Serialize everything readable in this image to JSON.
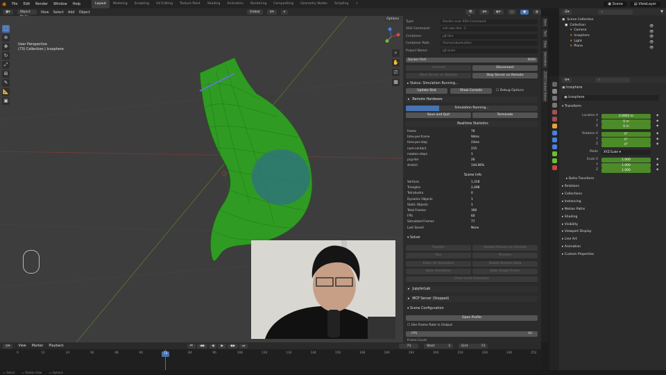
{
  "menu": [
    "File",
    "Edit",
    "Render",
    "Window",
    "Help"
  ],
  "workspaces": [
    "Layout",
    "Modeling",
    "Sculpting",
    "UV Editing",
    "Texture Paint",
    "Shading",
    "Animation",
    "Rendering",
    "Compositing",
    "Geometry Nodes",
    "Scripting"
  ],
  "active_workspace": "Layout",
  "scene_name": "Scene",
  "view_layer": "ViewLayer",
  "viewport": {
    "mode": "Object Mode",
    "menus": [
      "View",
      "Select",
      "Add",
      "Object"
    ],
    "transform_orientation": "Global",
    "options": "Options",
    "overlay_line1": "User Perspective",
    "overlay_line2": "(73) Collection | Icosphere"
  },
  "addon": {
    "fields": [
      {
        "k": "Type",
        "v": "Docker over SSH Command"
      },
      {
        "k": "SSH Command",
        "v": "ssh aws-dev -1"
      },
      {
        "k": "Container",
        "v": "pjf-dev"
      },
      {
        "k": "Container Path",
        "v": "/home/ubuntu/dev"
      },
      {
        "k": "Project Name",
        "v": "pjf-anim"
      }
    ],
    "docker_port_label": "Docker Port",
    "docker_port": "9090",
    "connect": "Connect",
    "disconnect": "Disconnect",
    "start_server": "Start Server on Remote",
    "stop_server": "Stop Server on Remote",
    "status": "Status: Simulation Running...",
    "update_stat": "Update Stat",
    "show_console": "Show Console",
    "debug_options": "Debug Options",
    "remote_hardware": "Remote Hardware",
    "progress_label": "Simulation Running...",
    "progress": 0.25,
    "save_quit": "Save and Quit",
    "terminate": "Terminate",
    "realtime_title": "Realtime Statistics",
    "realtime": [
      {
        "k": "frame",
        "v": "76"
      },
      {
        "k": "time-per-frame",
        "v": "94ms"
      },
      {
        "k": "time-per-step",
        "v": "23ms"
      },
      {
        "k": "num-contact",
        "v": "215"
      },
      {
        "k": "newton-steps",
        "v": "1"
      },
      {
        "k": "pcg-iter",
        "v": "26"
      },
      {
        "k": "stretch",
        "v": "144.06%"
      }
    ],
    "scene_info_title": "Scene Info",
    "scene_info": [
      {
        "k": "Vertices",
        "v": "1,318"
      },
      {
        "k": "Triangles",
        "v": "2,498"
      },
      {
        "k": "Tetrahedra",
        "v": "0"
      },
      {
        "k": "Dynamic Objects",
        "v": "1"
      },
      {
        "k": "Static Objects",
        "v": "1"
      },
      {
        "k": "Total Frames",
        "v": "300"
      },
      {
        "k": "FPS",
        "v": "60"
      },
      {
        "k": "Simulated Frames",
        "v": "77"
      },
      {
        "k": "Last Saved",
        "v": "None"
      }
    ],
    "solver_title": "Solver",
    "solver_buttons": [
      "Transfer",
      "Update Params on Remote",
      "Run",
      "Resume",
      "Fetch All Animation",
      "Delete Remote Data",
      "Bake Animation",
      "Bake Single Frame",
      "Clear Local Animation"
    ],
    "jupyter": "JupyterLab",
    "mcp": "MCP Server (Stopped)",
    "scene_config": "Scene Configuration",
    "open_profile": "Open Profile",
    "use_frame_rate": "Use Frame Rate in Output",
    "fps_label": "FPS",
    "fps_value": "60",
    "frame_count": "Frame Count"
  },
  "side_tabs": [
    "Item",
    "Tool",
    "View",
    "Animation",
    "ZOZO Contact Solver"
  ],
  "outliner": {
    "title": "Scene Collection",
    "items": [
      {
        "label": "Collection",
        "depth": 0
      },
      {
        "label": "Camera",
        "depth": 1
      },
      {
        "label": "Icosphere",
        "depth": 1
      },
      {
        "label": "Light",
        "depth": 1
      },
      {
        "label": "Plane",
        "depth": 1
      }
    ]
  },
  "properties": {
    "object_name": "Icosphere",
    "object_name2": "Icosphere",
    "transform": "Transform",
    "location": [
      {
        "axis": "Location X",
        "v": "2.0903 m"
      },
      {
        "axis": "Y",
        "v": "0 m"
      },
      {
        "axis": "Z",
        "v": "0 m"
      }
    ],
    "rotation": [
      {
        "axis": "Rotation X",
        "v": "0°"
      },
      {
        "axis": "Y",
        "v": "0°"
      },
      {
        "axis": "Z",
        "v": "0°"
      }
    ],
    "mode_label": "Mode",
    "mode": "XYZ Euler",
    "scale": [
      {
        "axis": "Scale X",
        "v": "1.000"
      },
      {
        "axis": "Y",
        "v": "1.000"
      },
      {
        "axis": "Z",
        "v": "1.000"
      }
    ],
    "delta": "Delta Transform",
    "sections": [
      "Relations",
      "Collections",
      "Instancing",
      "Motion Paths",
      "Shading",
      "Visibility",
      "Viewport Display",
      "Line Art",
      "Animation",
      "Custom Properties"
    ]
  },
  "timeline": {
    "menus": [
      "View",
      "Marker",
      "Playback"
    ],
    "current_frame": "73",
    "start_label": "Start",
    "start": "1",
    "end_label": "End",
    "end": "73",
    "ticks": [
      "0",
      "12",
      "24",
      "36",
      "48",
      "60",
      "72",
      "84",
      "96",
      "108",
      "120",
      "132",
      "144",
      "156",
      "168",
      "180",
      "192",
      "204",
      "216",
      "228",
      "240",
      "252"
    ]
  },
  "statusbar": [
    "Select",
    "Rotate View",
    "Options"
  ],
  "colors": {
    "accent": "#4772b3",
    "field_green": "#4d8a2a",
    "cloth": "#2f9b22"
  }
}
